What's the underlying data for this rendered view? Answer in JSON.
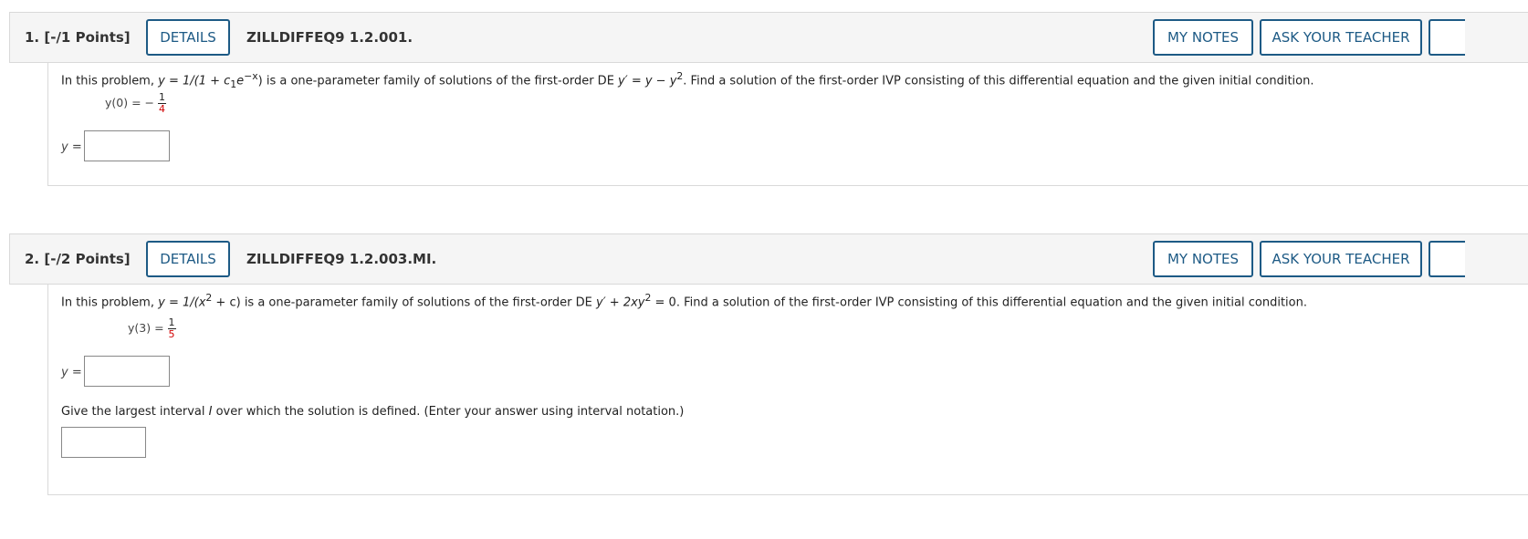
{
  "questions": [
    {
      "number": "1.",
      "points": "[-/1 Points]",
      "details_label": "DETAILS",
      "code": "ZILLDIFFEQ9 1.2.001.",
      "my_notes_label": "MY NOTES",
      "ask_label": "ASK YOUR TEACHER",
      "prompt_prefix": "In this problem, ",
      "prompt_family": "y = 1/(1 + c",
      "prompt_sub": "1",
      "prompt_e": "e",
      "prompt_exp": "−x",
      "prompt_mid": ") is a one-parameter family of solutions of the first-order DE ",
      "prompt_de": "y′ = y − y",
      "prompt_de_exp": "2",
      "prompt_suffix": ". Find a solution of the first-order IVP consisting of this differential equation and the given initial condition.",
      "ic_lhs": "y(0) = −",
      "ic_num": "1",
      "ic_den": "4",
      "answer_label": "y =",
      "answer_value": ""
    },
    {
      "number": "2.",
      "points": "[-/2 Points]",
      "details_label": "DETAILS",
      "code": "ZILLDIFFEQ9 1.2.003.MI.",
      "my_notes_label": "MY NOTES",
      "ask_label": "ASK YOUR TEACHER",
      "prompt_prefix": "In this problem, ",
      "prompt_family": "y = 1/(x",
      "prompt_family_exp": "2",
      "prompt_family_end": " + c)",
      "prompt_mid": " is a one-parameter family of solutions of the first-order DE ",
      "prompt_de": "y′ + 2xy",
      "prompt_de_exp": "2",
      "prompt_de_end": " = 0",
      "prompt_suffix": ". Find a solution of the first-order IVP consisting of this differential equation and the given initial condition.",
      "ic_lhs": "y(3) =",
      "ic_num": "1",
      "ic_den": "5",
      "answer_label": "y =",
      "answer_value": "",
      "interval_prompt_prefix": "Give the largest interval ",
      "interval_symbol": "I",
      "interval_prompt_suffix": " over which the solution is defined. (Enter your answer using interval notation.)",
      "interval_value": ""
    }
  ]
}
